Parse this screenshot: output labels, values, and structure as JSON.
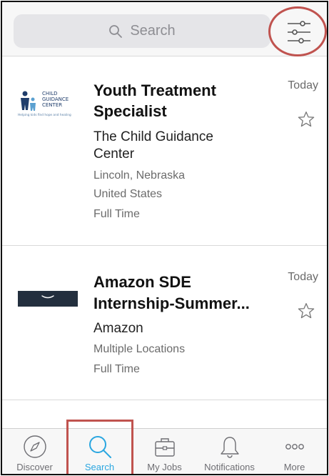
{
  "search": {
    "placeholder": "Search"
  },
  "jobs": [
    {
      "title": "Youth Treatment Specialist",
      "company": "The Child Guidance Center",
      "location_line1": "Lincoln, Nebraska",
      "location_line2": "United States",
      "employment_type": "Full Time",
      "date": "Today",
      "logo": {
        "line1": "CHILD",
        "line2": "GUIDANCE",
        "line3": "CENTER",
        "tagline": "Helping kids find hope and healing"
      }
    },
    {
      "title_line1": "Amazon SDE",
      "title_line2": "Internship-Summer...",
      "company": "Amazon",
      "location_line1": "Multiple Locations",
      "employment_type": "Full Time",
      "date": "Today"
    }
  ],
  "tabs": [
    {
      "label": "Discover",
      "icon": "compass-icon"
    },
    {
      "label": "Search",
      "icon": "search-icon"
    },
    {
      "label": "My Jobs",
      "icon": "briefcase-icon"
    },
    {
      "label": "Notifications",
      "icon": "bell-icon"
    },
    {
      "label": "More",
      "icon": "more-icon"
    }
  ],
  "colors": {
    "active_tab": "#2aa6e0",
    "highlight": "#c0534f",
    "amazon_dark": "#232f3e"
  }
}
